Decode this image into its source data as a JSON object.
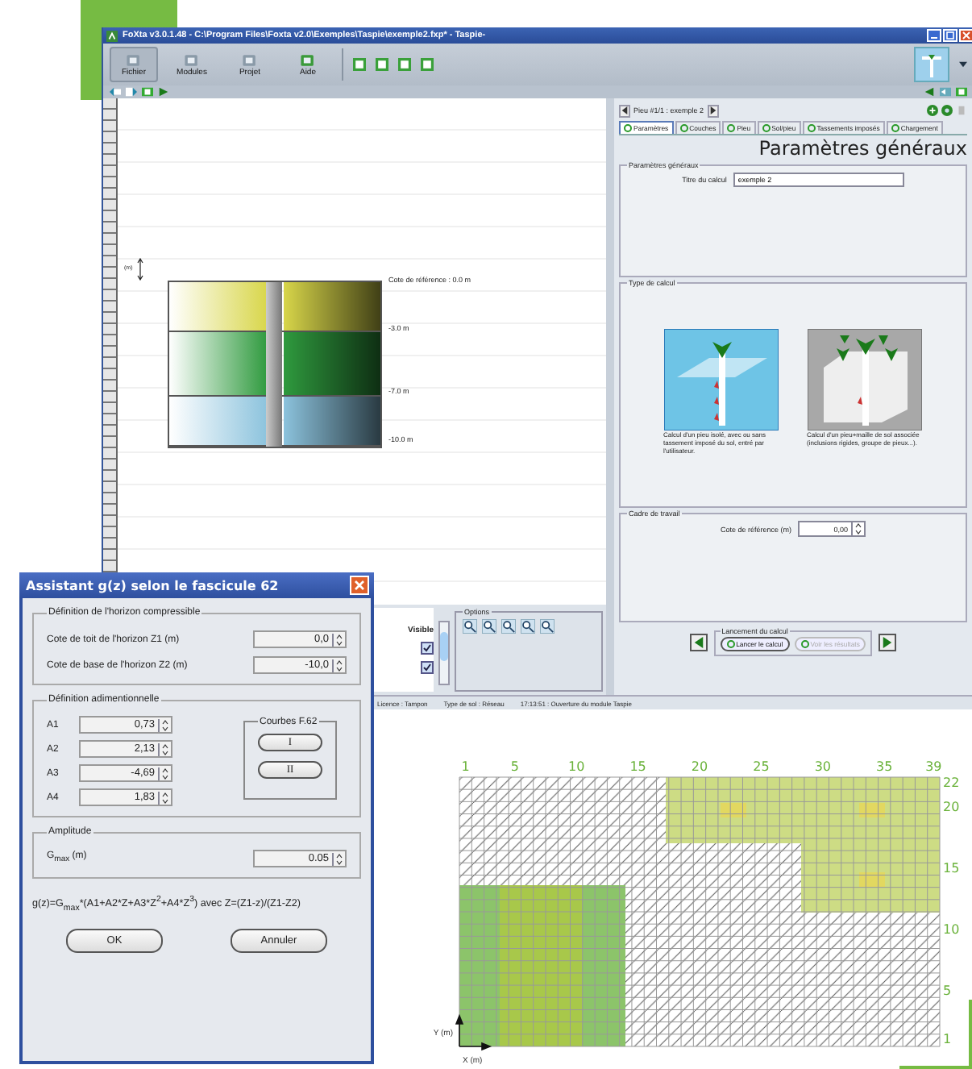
{
  "main_window": {
    "title": "FoXta v3.0.1.48 - C:\\Program Files\\Foxta v2.0\\Exemples\\Taspie\\exemple2.fxp* - Taspie-",
    "toolbar": [
      {
        "label": "Fichier",
        "selected": true
      },
      {
        "label": "Modules",
        "selected": false
      },
      {
        "label": "Projet",
        "selected": false
      },
      {
        "label": "Aide",
        "selected": false
      }
    ],
    "canvas": {
      "unit": "(m)",
      "layers": [
        {
          "color": "#d8d64a",
          "top": "Cote de référence : 0.0 m",
          "bottom": "-3.0 m"
        },
        {
          "color": "#2f9a3e",
          "bottom": "-7.0 m"
        },
        {
          "color": "#8cc3dd",
          "bottom": "-10.0 m"
        }
      ]
    },
    "layer_list": {
      "header": "Visible",
      "rows": [
        {
          "checked": true
        },
        {
          "checked": true
        }
      ]
    },
    "options": {
      "legend": "Options"
    },
    "side_panel": {
      "pile_nav": "Pieu #1/1 : exemple 2",
      "tabs": [
        {
          "label": "Paramètres",
          "selected": true
        },
        {
          "label": "Couches",
          "selected": false
        },
        {
          "label": "Pieu",
          "selected": false
        },
        {
          "label": "Sol/pieu",
          "selected": false
        },
        {
          "label": "Tassements imposés",
          "selected": false
        },
        {
          "label": "Chargement",
          "selected": false
        }
      ],
      "heading": "Paramètres généraux",
      "general": {
        "legend": "Paramètres généraux",
        "label": "Titre du calcul",
        "value": "exemple 2"
      },
      "calc_type": {
        "legend": "Type de calcul",
        "options": [
          {
            "kind": "single",
            "caption": "Calcul d'un pieu isolé, avec ou sans tassement imposé du sol, entré par l'utilisateur.",
            "selected": true
          },
          {
            "kind": "group",
            "caption": "Calcul d'un pieu+maille de sol associée (inclusions rigides, groupe de pieux...).",
            "selected": false
          }
        ]
      },
      "frame": {
        "legend": "Cadre de travail",
        "label": "Cote de référence (m)",
        "value": "0,00"
      },
      "launch": {
        "legend": "Lancement du calcul",
        "run": "Lancer le calcul",
        "results": {
          "label": "Voir les résultats",
          "disabled": true
        }
      }
    },
    "status_bar": [
      "Licence : Tampon",
      "Type de sol : Réseau",
      "17:13:51 : Ouverture du module Taspie"
    ]
  },
  "dialog": {
    "title": "Assistant g(z) selon le fascicule 62",
    "horizon": {
      "legend": "Définition de l'horizon compressible",
      "rows": [
        {
          "label": "Cote de toit de l'horizon Z1 (m)",
          "value": "0,0"
        },
        {
          "label": "Cote de base de l'horizon Z2 (m)",
          "value": "-10,0"
        }
      ]
    },
    "coefficients": {
      "legend": "Définition adimentionnelle",
      "rows": [
        {
          "label": "A1",
          "value": "0,73"
        },
        {
          "label": "A2",
          "value": "2,13"
        },
        {
          "label": "A3",
          "value": "-4,69"
        },
        {
          "label": "A4",
          "value": "1,83"
        }
      ],
      "curves": {
        "legend": "Courbes F.62",
        "buttons": [
          "I",
          "II"
        ]
      }
    },
    "amplitude": {
      "legend": "Amplitude",
      "label": "G$_{max}$ (m)",
      "value": "0.05"
    },
    "formula": "g(z)=G$_{max}$*(A1+A2*Z+A3*Z$^{2}$+A4*Z$^{3}$) avec Z=(Z1-z)/(Z1-Z2)",
    "buttons": [
      "OK",
      "Annuler"
    ]
  },
  "mesh": {
    "x_labels": [
      "1",
      "5",
      "10",
      "15",
      "20",
      "25",
      "30",
      "35",
      "39"
    ],
    "y_labels": [
      "22",
      "20",
      "15",
      "10",
      "5",
      "1"
    ],
    "y_axis": "Y (m)",
    "x_axis": "X (m)"
  }
}
